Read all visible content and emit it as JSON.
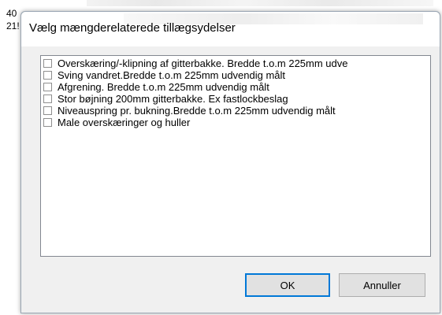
{
  "background": {
    "line1": "40",
    "line2": "21!"
  },
  "dialog": {
    "title": "Vælg mængderelaterede tillægsydelser",
    "items": [
      {
        "label": "Overskæring/-klipning af gitterbakke. Bredde t.o.m 225mm udve",
        "checked": false
      },
      {
        "label": "Sving vandret.Bredde t.o.m 225mm udvendig målt",
        "checked": false
      },
      {
        "label": "Afgrening. Bredde t.o.m 225mm udvendig målt",
        "checked": false
      },
      {
        "label": "Stor bøjning 200mm gitterbakke. Ex fastlockbeslag",
        "checked": false
      },
      {
        "label": "Niveauspring pr. bukning.Bredde t.o.m 225mm udvendig målt",
        "checked": false
      },
      {
        "label": "Male overskæringer og huller",
        "checked": false
      }
    ],
    "ok_label": "OK",
    "cancel_label": "Annuller"
  },
  "colors": {
    "dialog_bg": "#f0f0f0",
    "button_bg": "#e1e1e1",
    "default_button_border": "#0078d7",
    "list_border": "#828790"
  }
}
